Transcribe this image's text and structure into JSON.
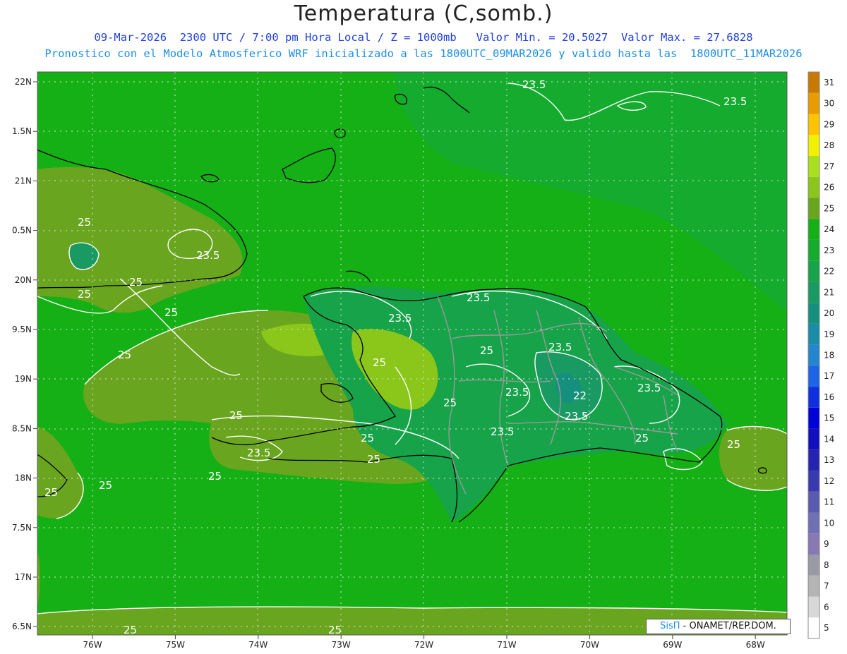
{
  "title": "Temperatura (C,somb.)",
  "subtitle1": "09-Mar-2026  2300 UTC / 7:00 pm Hora Local / Z = 1000mb   Valor Min. = 20.5027  Valor Max. = 27.6828",
  "subtitle2": "Pronostico con el Modelo Atmosferico WRF inicializado a las 1800UTC_09MAR2026 y valido hasta las  1800UTC_11MAR2026",
  "credit": {
    "brand": "SisΠ",
    "text": " - ONAMET/REP.DOM."
  },
  "lat_labels": [
    "22N",
    "1.5N",
    "21N",
    "0.5N",
    "20N",
    "9.5N",
    "19N",
    "8.5N",
    "18N",
    "7.5N",
    "17N",
    "6.5N"
  ],
  "lon_labels": [
    "76W",
    "75W",
    "74W",
    "73W",
    "72W",
    "71W",
    "70W",
    "69W",
    "68W"
  ],
  "colorbar": {
    "labels": [
      "5",
      "6",
      "7",
      "8",
      "9",
      "10",
      "11",
      "12",
      "13",
      "14",
      "15",
      "16",
      "17",
      "18",
      "19",
      "20",
      "21",
      "22",
      "23",
      "24",
      "25",
      "26",
      "27",
      "28",
      "29",
      "30",
      "31"
    ],
    "colors": [
      "#ffffff",
      "#d8d8d8",
      "#b4b4b4",
      "#9a9aa6",
      "#8878b4",
      "#7070b4",
      "#5a5ab0",
      "#3a3ab0",
      "#2424b0",
      "#1010bf",
      "#0000d8",
      "#1030e0",
      "#1e64e6",
      "#2486cf",
      "#1a8ca8",
      "#16907e",
      "#1a9a63",
      "#17a34a",
      "#14ab2e",
      "#15b015",
      "#6aa51f",
      "#8bc61a",
      "#a9df1d",
      "#f0f000",
      "#ffc400",
      "#e89c00",
      "#c87a00"
    ]
  },
  "contour_labels": [
    "23.5",
    "23.5",
    "25",
    "23.5",
    "25",
    "25",
    "25",
    "25",
    "25",
    "23.5",
    "23.5",
    "25",
    "25",
    "23.5",
    "23.5",
    "22",
    "23.5",
    "23.5",
    "25",
    "25",
    "23.5",
    "25",
    "23.5",
    "25",
    "25",
    "25",
    "25",
    "25",
    "25",
    "25"
  ],
  "colors": {
    "sea_green": "#15b015",
    "land_low": "#6aa51f",
    "land_warm": "#8bc61a",
    "land_cool": "#1a9a63",
    "north_cool": "#14ab2e"
  }
}
